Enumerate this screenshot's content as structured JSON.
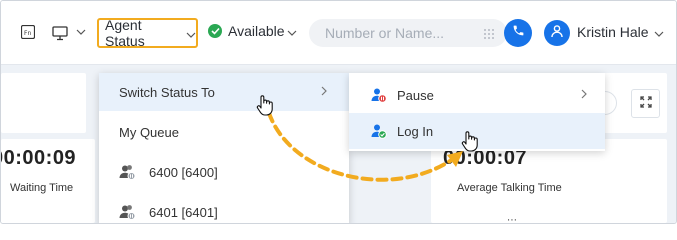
{
  "topbar": {
    "agent_status_label": "Agent Status",
    "availability_label": "Available",
    "search_placeholder": "Number or Name...",
    "user_name": "Kristin Hale"
  },
  "stats": {
    "waiting": {
      "time": "00:00:09",
      "label": "Waiting Time"
    },
    "talking": {
      "time": "00:00:07",
      "label": "Average Talking Time"
    }
  },
  "status_menu": {
    "items": [
      {
        "label": "Switch Status To"
      },
      {
        "label": "My Queue"
      },
      {
        "label": "6400 [6400]"
      },
      {
        "label": "6401 [6401]"
      }
    ]
  },
  "submenu": {
    "items": [
      {
        "label": "Pause"
      },
      {
        "label": "Log In"
      }
    ]
  },
  "colors": {
    "accent": "#1773e8",
    "highlight_border": "#f2ab1f",
    "available": "#2aa853",
    "menu_hover": "#e8f1fb",
    "annotation_arrow": "#f2ab1f"
  }
}
